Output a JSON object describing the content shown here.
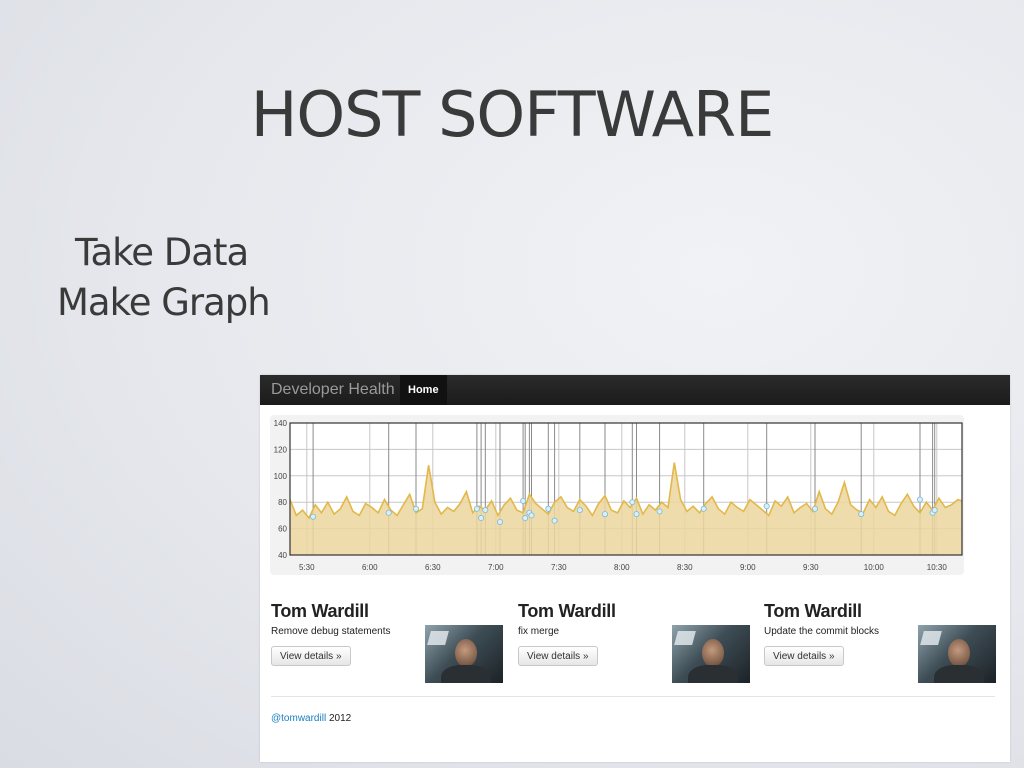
{
  "slide": {
    "title": "HOST SOFTWARE",
    "bullets": [
      "Take Data",
      "Make Graph"
    ]
  },
  "app": {
    "brand": "Developer Health",
    "nav": [
      {
        "label": "Home",
        "active": true
      }
    ]
  },
  "chart_data": {
    "type": "area",
    "title": "",
    "xlabel": "",
    "ylabel": "",
    "ylim": [
      40,
      140
    ],
    "yticks": [
      "40",
      "60",
      "80",
      "100",
      "120",
      "140"
    ],
    "xlim": [
      "5:22",
      "10:42"
    ],
    "xticks": [
      {
        "time": "5:30",
        "label": "5:30"
      },
      {
        "time": "6:00",
        "label": "6:00"
      },
      {
        "time": "6:30",
        "label": "6:30"
      },
      {
        "time": "7:00",
        "label": "7:00"
      },
      {
        "time": "7:30",
        "label": "7:30"
      },
      {
        "time": "8:00",
        "label": "8:00"
      },
      {
        "time": "8:30",
        "label": "8:30"
      },
      {
        "time": "9:00",
        "label": "9:00"
      },
      {
        "time": "9:30",
        "label": "9:30"
      },
      {
        "time": "10:00",
        "label": "10:00"
      },
      {
        "time": "10:30",
        "label": "10:30"
      }
    ],
    "grid": true,
    "series": [
      {
        "color": "#e3b84a",
        "fill": "#ecd69d",
        "x": [
          "5:22",
          "5:25",
          "5:28",
          "5:31",
          "5:34",
          "5:37",
          "5:40",
          "5:43",
          "5:46",
          "5:49",
          "5:52",
          "5:55",
          "5:58",
          "6:01",
          "6:04",
          "6:07",
          "6:10",
          "6:13",
          "6:16",
          "6:19",
          "6:22",
          "6:25",
          "6:28",
          "6:31",
          "6:34",
          "6:37",
          "6:40",
          "6:43",
          "6:46",
          "6:49",
          "6:52",
          "6:55",
          "6:58",
          "7:01",
          "7:04",
          "7:07",
          "7:10",
          "7:13",
          "7:16",
          "7:19",
          "7:22",
          "7:25",
          "7:28",
          "7:31",
          "7:34",
          "7:37",
          "7:40",
          "7:43",
          "7:46",
          "7:49",
          "7:52",
          "7:55",
          "7:58",
          "8:01",
          "8:04",
          "8:07",
          "8:10",
          "8:13",
          "8:16",
          "8:19",
          "8:22",
          "8:25",
          "8:28",
          "8:31",
          "8:34",
          "8:37",
          "8:40",
          "8:43",
          "8:46",
          "8:49",
          "8:52",
          "8:55",
          "8:58",
          "9:01",
          "9:04",
          "9:07",
          "9:10",
          "9:13",
          "9:16",
          "9:19",
          "9:22",
          "9:25",
          "9:28",
          "9:31",
          "9:34",
          "9:37",
          "9:40",
          "9:43",
          "9:46",
          "9:49",
          "9:52",
          "9:55",
          "9:58",
          "10:01",
          "10:04",
          "10:07",
          "10:10",
          "10:13",
          "10:16",
          "10:19",
          "10:22",
          "10:25",
          "10:28",
          "10:31",
          "10:34",
          "10:37",
          "10:40",
          "10:42"
        ],
        "values": [
          82,
          70,
          74,
          68,
          78,
          72,
          80,
          71,
          75,
          84,
          73,
          70,
          79,
          76,
          72,
          82,
          74,
          70,
          78,
          86,
          72,
          75,
          108,
          80,
          71,
          76,
          73,
          79,
          88,
          72,
          77,
          74,
          81,
          70,
          78,
          83,
          74,
          72,
          86,
          79,
          75,
          71,
          80,
          84,
          76,
          73,
          82,
          77,
          70,
          79,
          85,
          74,
          72,
          81,
          76,
          83,
          71,
          78,
          74,
          80,
          76,
          110,
          82,
          73,
          77,
          72,
          79,
          84,
          75,
          71,
          80,
          76,
          73,
          82,
          78,
          74,
          70,
          81,
          77,
          84,
          72,
          76,
          79,
          73,
          88,
          75,
          71,
          80,
          95,
          78,
          74,
          72,
          82,
          76,
          84,
          73,
          70,
          79,
          86,
          77,
          72,
          80,
          74,
          83,
          76,
          78,
          82,
          81
        ]
      }
    ],
    "events": [
      "5:33",
      "6:09",
      "6:22",
      "6:51",
      "6:53",
      "6:55",
      "7:02",
      "7:13",
      "7:14",
      "7:16",
      "7:17",
      "7:25",
      "7:28",
      "7:40",
      "7:52",
      "8:05",
      "8:07",
      "8:18",
      "8:39",
      "9:09",
      "9:32",
      "9:54",
      "10:22",
      "10:28",
      "10:29"
    ],
    "event_values": [
      69,
      72,
      75,
      75,
      68,
      74,
      65,
      81,
      68,
      72,
      70,
      75,
      66,
      74,
      71,
      80,
      71,
      73,
      75,
      77,
      75,
      71,
      82,
      72,
      74
    ]
  },
  "commits": [
    {
      "author": "Tom Wardill",
      "message": "Remove debug statements",
      "button": "View details »"
    },
    {
      "author": "Tom Wardill",
      "message": "fix merge",
      "button": "View details »"
    },
    {
      "author": "Tom Wardill",
      "message": "Update the commit blocks",
      "button": "View details »"
    }
  ],
  "footer": {
    "handle": "@tomwardill",
    "year": " 2012"
  }
}
